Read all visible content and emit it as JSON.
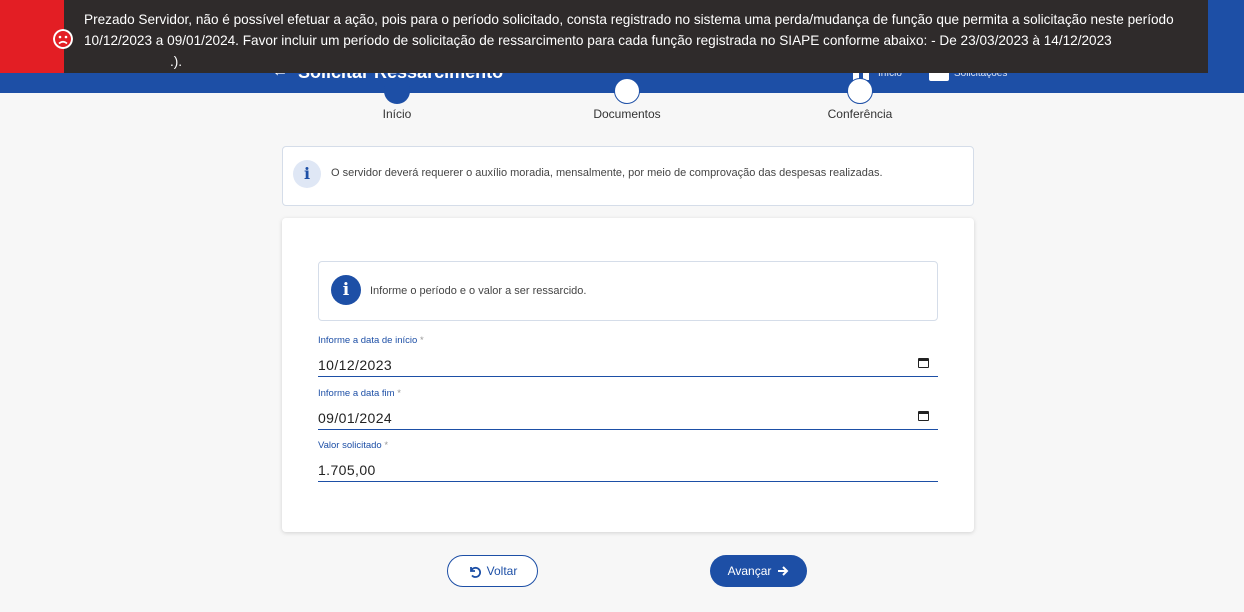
{
  "header": {
    "back_icon": "arrow-left-icon",
    "title": "Solicitar Ressarcimento",
    "home_icon": "home-icon",
    "home_label": "Início",
    "calendar_icon": "calendar-icon",
    "calendar_label": "Solicitações"
  },
  "toast": {
    "type": "error",
    "icon": "sad-face-icon",
    "message": "Prezado Servidor, não é possível efetuar a ação, pois para o período solicitado, consta registrado no sistema uma perda/mudança de função que permita a solicitação neste período 10/12/2023 a 09/01/2024. Favor incluir um período de solicitação de ressarcimento para cada função registrada no SIAPE conforme abaixo: - De 23/03/2023 à 14/12/2023",
    "message_tail": ".).",
    "colors": {
      "accent": "#e31e24",
      "background": "#2f2b2b"
    }
  },
  "stepper": {
    "steps": [
      {
        "label": "Início",
        "active": true
      },
      {
        "label": "Documentos",
        "active": false
      },
      {
        "label": "Conferência",
        "active": false
      }
    ]
  },
  "info_notice": {
    "icon": "info-icon",
    "text": "O servidor deverá requerer o auxílio moradia, mensalmente, por meio de comprovação das despesas realizadas."
  },
  "form": {
    "notice": {
      "icon": "info-icon",
      "text": "Informe o período e o valor a ser ressarcido."
    },
    "start_date": {
      "label": "Informe a data de início",
      "required_mark": "*",
      "value": "10/12/2023",
      "icon": "calendar-icon"
    },
    "end_date": {
      "label": "Informe a data fim",
      "required_mark": "*",
      "value": "09/01/2024",
      "icon": "calendar-icon"
    },
    "amount": {
      "label": "Valor solicitado",
      "required_mark": "*",
      "value": "1.705,00"
    }
  },
  "actions": {
    "back_label": "Voltar",
    "back_icon": "undo-icon",
    "next_label": "Avançar",
    "next_icon": "arrow-right-icon"
  },
  "colors": {
    "primary": "#1d4fa6",
    "page_bg": "#f7f7f7"
  }
}
